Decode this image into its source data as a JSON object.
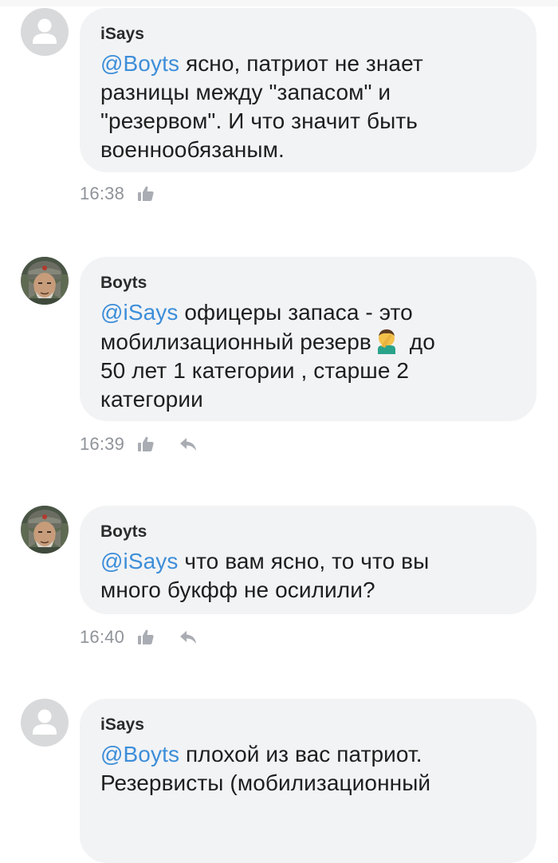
{
  "comments": [
    {
      "author": "iSays",
      "mention": "@Boyts",
      "body_lines": [
        " ясно, патриот не знает",
        "разницы между \"запасом\" и",
        "\"резервом\". И что значит быть",
        "военнообязаным."
      ],
      "time": "16:38",
      "avatar": "default-avatar",
      "has_reply": false
    },
    {
      "author": "Boyts",
      "mention": "@iSays",
      "body_lines": [
        " офицеры запаса - это",
        "мобилизационный резерв",
        " до",
        "50 лет 1 категории , старше 2",
        "категории"
      ],
      "emoji": "facepalm-emoji",
      "time": "16:39",
      "avatar": "photo-avatar",
      "has_reply": true
    },
    {
      "author": "Boyts",
      "mention": "@iSays",
      "body_lines": [
        " что вам ясно, то что вы",
        "много букфф не осилили?"
      ],
      "time": "16:40",
      "avatar": "photo-avatar",
      "has_reply": true
    },
    {
      "author": "iSays",
      "mention": "@Boyts",
      "body_lines": [
        " плохой из вас патриот.",
        "Резервисты (мобилизационный"
      ],
      "avatar": "default-avatar"
    }
  ],
  "colors": {
    "mention": "#3d8ed9",
    "bubble": "#f2f3f5",
    "meta": "#8f9399",
    "icon": "#a9adb3"
  }
}
